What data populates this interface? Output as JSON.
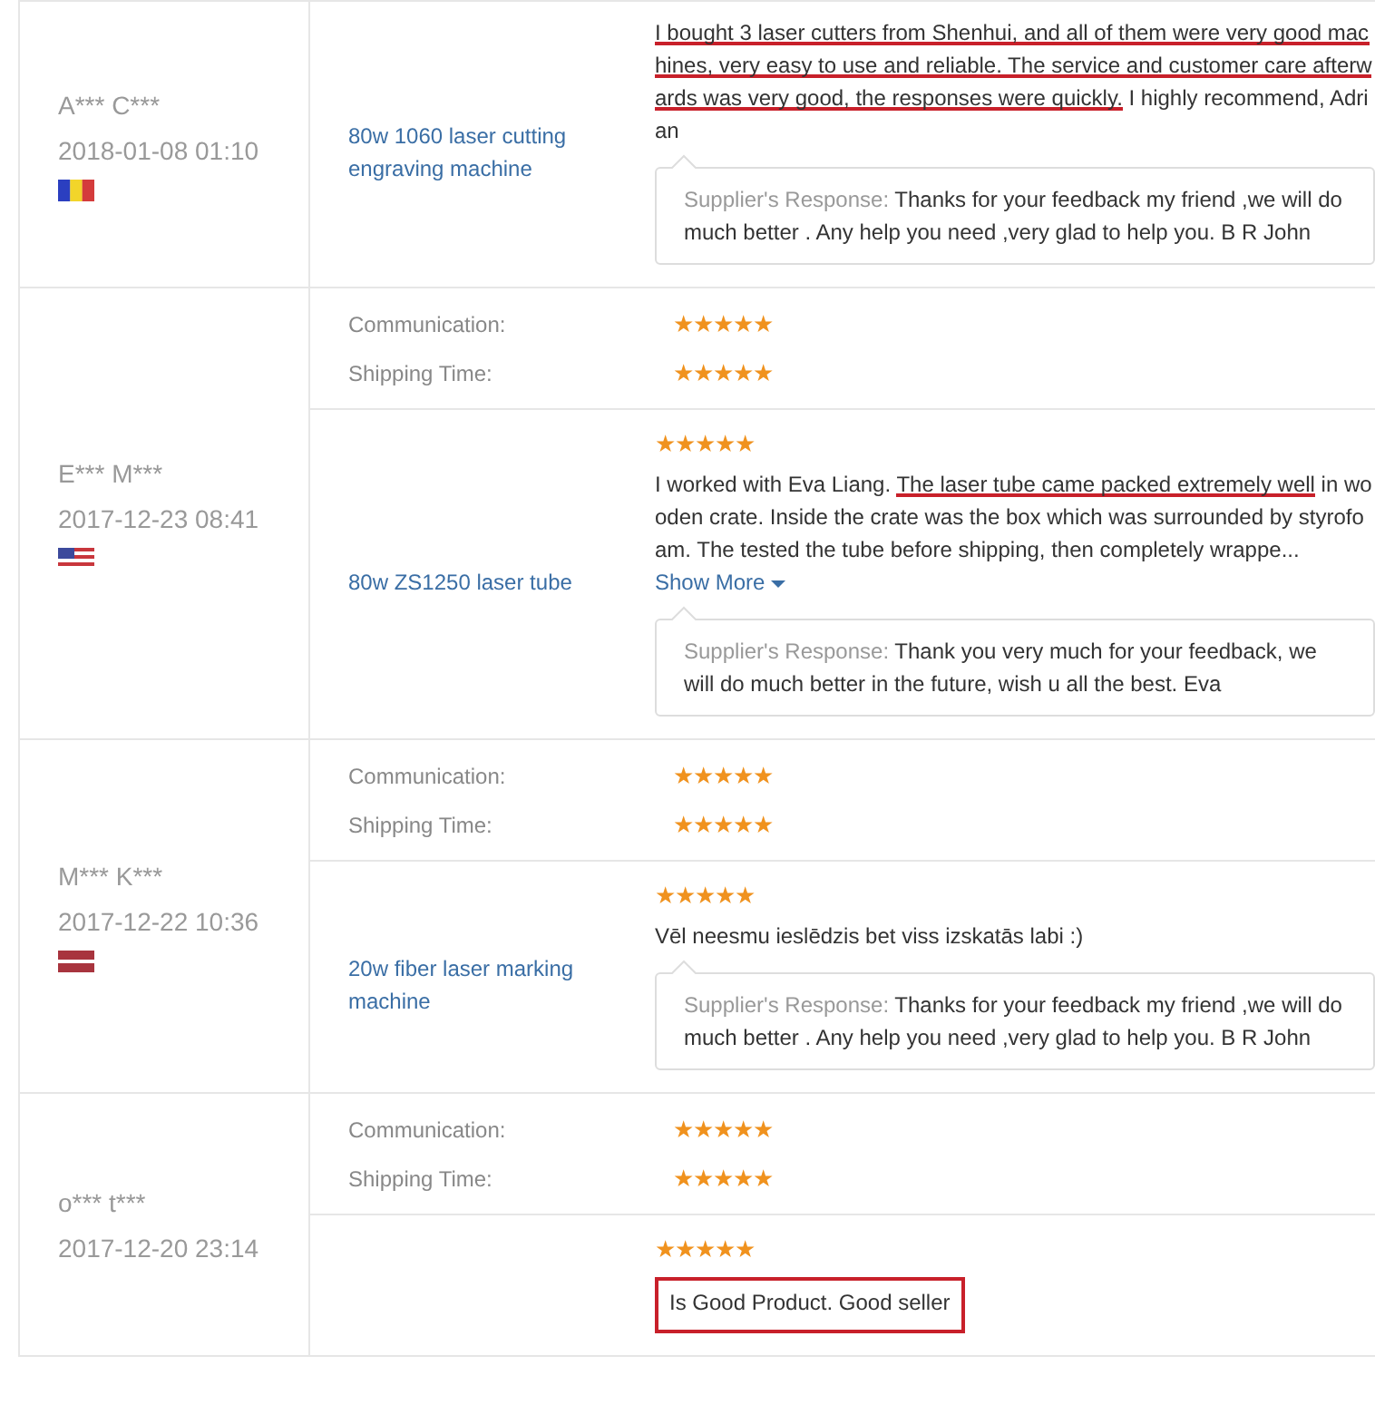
{
  "reviews": [
    {
      "reviewer": "A*** C***",
      "date": "2018-01-08 01:10",
      "flag": {
        "kind": "vertical",
        "stripes": [
          {
            "color": "#2b3fc0"
          },
          {
            "color": "#f2d52a"
          },
          {
            "color": "#d43c3c"
          }
        ]
      },
      "product": "80w 1060 laser cutting engraving machine",
      "text": [
        {
          "text": "I bought 3 laser cutters from Shenhui, and all of them were very good machines, very easy to use and reliable. The service and customer care afterwards was very good, the responses were quickly.",
          "underlined": true,
          "boxed": false
        },
        {
          "text": " I highly recommend, Adrian",
          "underlined": false,
          "boxed": false
        }
      ],
      "response": {
        "label": "Supplier's Response:",
        "text": "Thanks for your feedback my friend ,we will do much better . Any help you need ,very glad to help you. B R John"
      }
    },
    {
      "reviewer": "E*** M***",
      "date": "2017-12-23 08:41",
      "flag": {
        "kind": "stars",
        "stripes": [
          {
            "color": "#c8363c"
          },
          {
            "color": "#ffffff"
          },
          {
            "color": "#3c4a9c"
          }
        ]
      },
      "ratings": [
        {
          "label": "Communication:",
          "stars": 5
        },
        {
          "label": "Shipping Time:",
          "stars": 5
        }
      ],
      "product": "80w ZS1250 laser tube",
      "stars": 5,
      "text": [
        {
          "text": "I worked with Eva Liang. ",
          "underlined": false,
          "boxed": false
        },
        {
          "text": "The laser tube came packed extremely well",
          "underlined": true,
          "boxed": false
        },
        {
          "text": " in wooden crate. Inside the crate was the box which was surrounded by styrofoam. The tested the tube before shipping, then completely wrappe...",
          "underlined": false,
          "boxed": false
        }
      ],
      "show_more": "Show More",
      "response": {
        "label": "Supplier's Response:",
        "text": "Thank you very much for your feedback, we will do much better in the future, wish u all the best. Eva"
      }
    },
    {
      "reviewer": "M*** K***",
      "date": "2017-12-22 10:36",
      "flag": {
        "kind": "horizontal",
        "stripes": [
          {
            "color": "#a8343e"
          },
          {
            "color": "#ffffff"
          },
          {
            "color": "#a8343e"
          }
        ]
      },
      "ratings": [
        {
          "label": "Communication:",
          "stars": 5
        },
        {
          "label": "Shipping Time:",
          "stars": 5
        }
      ],
      "product": "20w fiber laser marking machine",
      "stars": 5,
      "text": [
        {
          "text": "Vēl neesmu ieslēdzis bet viss izskatās labi :)",
          "underlined": false,
          "boxed": false
        }
      ],
      "response": {
        "label": "Supplier's Response:",
        "text": "Thanks for your feedback my friend ,we will do much better . Any help you need ,very glad to help you. B R John"
      }
    },
    {
      "reviewer": "o*** t***",
      "date": "2017-12-20 23:14",
      "ratings": [
        {
          "label": "Communication:",
          "stars": 5
        },
        {
          "label": "Shipping Time:",
          "stars": 5
        }
      ],
      "stars": 5,
      "text": [
        {
          "text": "Is Good Product. Good seller",
          "underlined": false,
          "boxed": true
        }
      ]
    }
  ]
}
